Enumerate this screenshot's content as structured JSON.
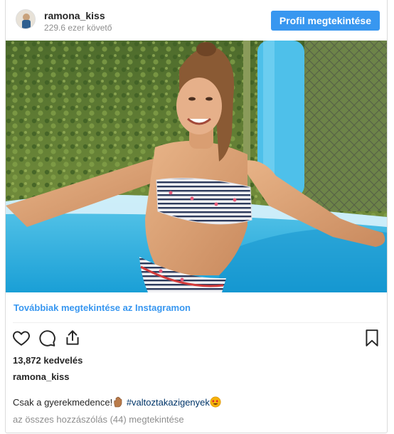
{
  "header": {
    "username": "ramona_kiss",
    "followers": "229.6 ezer követő",
    "profile_button": "Profil megtekintése"
  },
  "post": {
    "image_icon": "photo-bikini-pool",
    "more_link": "Továbbiak megtekintése az Instagramon",
    "likes": "13,872 kedvelés",
    "author": "ramona_kiss",
    "caption_text": "Csak a gyerekmedence!",
    "caption_emoji_1": "raised-hand-emoji",
    "hashtag": "#valtoztakazigenyek",
    "caption_emoji_2": "heart-eyes-emoji",
    "comments_link": "az összes hozzászólás (44) megtekintése"
  },
  "actions": {
    "like_icon": "heart-icon",
    "comment_icon": "comment-icon",
    "share_icon": "share-icon",
    "save_icon": "bookmark-icon"
  },
  "colors": {
    "accent": "#3897f0",
    "hashtag": "#003569",
    "muted": "#8e8e8e",
    "text": "#262626"
  }
}
